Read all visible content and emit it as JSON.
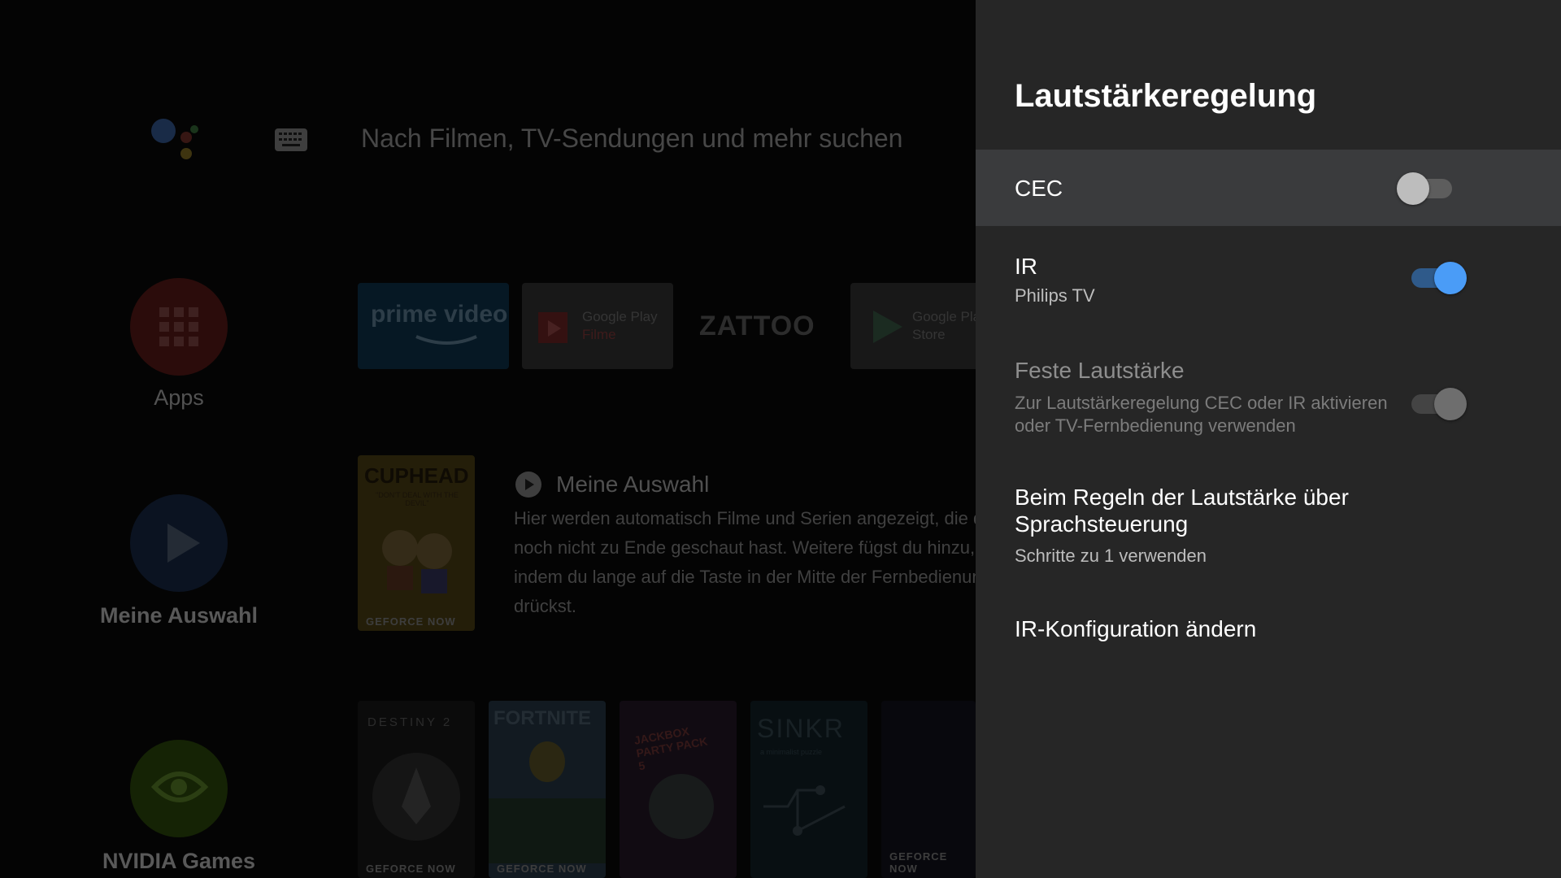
{
  "launcher": {
    "search_placeholder": "Nach Filmen, TV-Sendungen und mehr suchen",
    "side_nav": [
      {
        "label": "Apps",
        "icon": "apps-grid-icon"
      },
      {
        "label": "Meine Auswahl",
        "icon": "play-icon"
      },
      {
        "label": "NVIDIA Games",
        "icon": "nvidia-icon"
      }
    ],
    "app_tiles": [
      {
        "name": "prime video",
        "line1": "prime video"
      },
      {
        "name": "Google Play Filme",
        "line1": "Google Play",
        "line2": "Filme"
      },
      {
        "name": "ZATTOO",
        "line1": "ZATTOO"
      },
      {
        "name": "Google Play Store",
        "line1": "Google Play",
        "line2": "Store"
      }
    ],
    "featured_card": {
      "title": "CUPHEAD",
      "subtitle": "\"DON'T DEAL WITH THE DEVIL\"",
      "badge": "GEFORCE NOW"
    },
    "row_title": "Meine Auswahl",
    "row_description": "Hier werden automatisch Filme und Serien angezeigt, die du noch nicht zu Ende geschaut hast. Weitere fügst du hinzu, indem du lange auf die Taste in der Mitte der Fernbedienung drückst.",
    "game_cards": [
      {
        "title": "DESTINY 2",
        "badge": "GEFORCE NOW"
      },
      {
        "title": "FORTNITE",
        "badge": "GEFORCE NOW"
      },
      {
        "title": "JACKBOX PARTY PACK 5",
        "badge": ""
      },
      {
        "title": "SINKR",
        "subtitle": "a minimalist puzzle",
        "badge": ""
      },
      {
        "title": "",
        "badge": "GEFORCE NOW"
      }
    ]
  },
  "panel": {
    "title": "Lautstärkeregelung",
    "items": [
      {
        "title": "CEC",
        "subtitle": "",
        "toggle": false,
        "enabled": true,
        "focused": true
      },
      {
        "title": "IR",
        "subtitle": "Philips TV",
        "toggle": true,
        "enabled": true
      },
      {
        "title": "Feste Lautstärke",
        "subtitle_lines": [
          "Zur Lautstärkeregelung CEC oder IR aktivieren",
          "oder TV-Fernbedienung verwenden"
        ],
        "toggle": false,
        "enabled": false
      },
      {
        "title_lines": [
          "Beim Regeln der Lautstärke über",
          "Sprachsteuerung"
        ],
        "subtitle": "Schritte zu 1 verwenden"
      },
      {
        "title": "IR-Konfiguration ändern"
      }
    ]
  },
  "colors": {
    "panel_bg": "#262626",
    "focused_row": "#3a3b3d",
    "toggle_on_thumb": "#4a9cf7",
    "toggle_on_track": "#2f5a8a",
    "toggle_off_thumb": "#bdbdbd",
    "toggle_off_track": "#5d5d5d"
  }
}
